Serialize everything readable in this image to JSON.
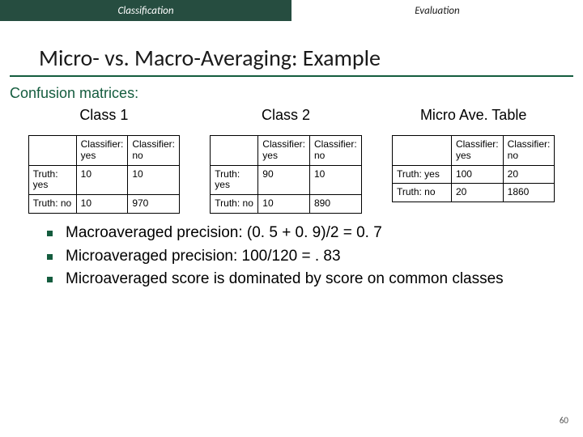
{
  "topbar": {
    "active": "Classification",
    "inactive": "Evaluation"
  },
  "title": "Micro- vs. Macro-Averaging: Example",
  "subhead": "Confusion matrices:",
  "tables": [
    {
      "title": "Class 1",
      "col1": "Classifier: yes",
      "col2": "Classifier: no",
      "row1label": "Truth: yes",
      "row2label": "Truth: no",
      "v11": "10",
      "v12": "10",
      "v21": "10",
      "v22": "970"
    },
    {
      "title": "Class 2",
      "col1": "Classifier: yes",
      "col2": "Classifier: no",
      "row1label": "Truth: yes",
      "row2label": "Truth: no",
      "v11": "90",
      "v12": "10",
      "v21": "10",
      "v22": "890"
    },
    {
      "title": "Micro Ave. Table",
      "col1": "Classifier: yes",
      "col2": "Classifier: no",
      "row1label": "Truth: yes",
      "row2label": "Truth: no",
      "v11": "100",
      "v12": "20",
      "v21": "20",
      "v22": "1860"
    }
  ],
  "bullets": [
    "Macroaveraged precision: (0. 5 + 0. 9)/2 = 0. 7",
    "Microaveraged precision: 100/120 = . 83",
    "Microaveraged score is dominated by score on common classes"
  ],
  "pagenum": "60",
  "chart_data": {
    "type": "table",
    "description": "Three 2x2 confusion matrices",
    "matrices": [
      {
        "name": "Class 1",
        "truth_yes_classifier_yes": 10,
        "truth_yes_classifier_no": 10,
        "truth_no_classifier_yes": 10,
        "truth_no_classifier_no": 970
      },
      {
        "name": "Class 2",
        "truth_yes_classifier_yes": 90,
        "truth_yes_classifier_no": 10,
        "truth_no_classifier_yes": 10,
        "truth_no_classifier_no": 890
      },
      {
        "name": "Micro Ave. Table",
        "truth_yes_classifier_yes": 100,
        "truth_yes_classifier_no": 20,
        "truth_no_classifier_yes": 20,
        "truth_no_classifier_no": 1860
      }
    ]
  }
}
